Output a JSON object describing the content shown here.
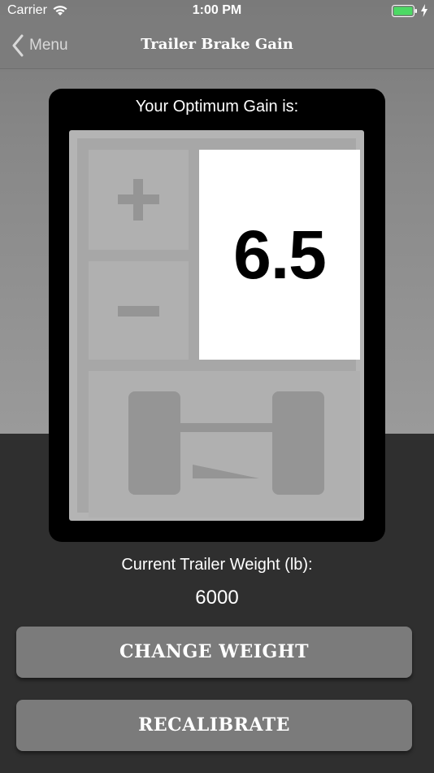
{
  "status_bar": {
    "carrier": "Carrier",
    "time": "1:00 PM",
    "battery_color": "#4cd964"
  },
  "nav": {
    "back_label": "Menu",
    "title": "Trailer Brake Gain"
  },
  "gain": {
    "heading": "Your Optimum Gain is:",
    "value": "6.5",
    "plus_icon": "plus-icon",
    "minus_icon": "minus-icon",
    "axle_icon": "trailer-axle-icon"
  },
  "weight": {
    "label": "Current Trailer Weight (lb):",
    "value": "6000"
  },
  "buttons": {
    "change_weight": "CHANGE WEIGHT",
    "recalibrate": "RECALIBRATE"
  },
  "colors": {
    "card": "#000000",
    "panel": "#b4b4b4",
    "button": "#7b7b7b",
    "bottom_bg": "#2f2f2f"
  }
}
